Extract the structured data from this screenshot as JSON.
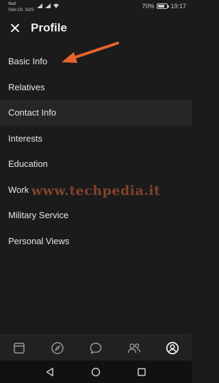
{
  "status_bar": {
    "carrier_line1": "Iliad",
    "carrier_line2": "Solo Ch. SOS",
    "battery": "70%",
    "battery_level": 0.7,
    "time": "19:17"
  },
  "header": {
    "title": "Profile",
    "close_icon": "close-icon"
  },
  "menu": {
    "items": [
      {
        "label": "Basic Info"
      },
      {
        "label": "Relatives"
      },
      {
        "label": "Contact Info"
      },
      {
        "label": "Interests"
      },
      {
        "label": "Education"
      },
      {
        "label": "Work"
      },
      {
        "label": "Military Service"
      },
      {
        "label": "Personal Views"
      }
    ]
  },
  "watermark": {
    "text": "www.techpedia.it"
  },
  "bottom_nav": {
    "icons": [
      "news-icon",
      "compass-icon",
      "chat-icon",
      "friends-icon",
      "profile-icon"
    ]
  },
  "system_nav": {
    "icons": [
      "back-icon",
      "home-icon",
      "recents-icon"
    ]
  },
  "colors": {
    "background": "#1b1b1b",
    "arrow": "#e8642c",
    "highlight_row": "#262626"
  }
}
